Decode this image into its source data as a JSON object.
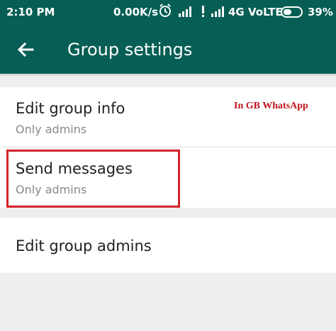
{
  "status_bar": {
    "time": "2:10 PM",
    "speed": "0.00K/s",
    "network": "4G VoLTE",
    "battery": "39%"
  },
  "app_bar": {
    "title": "Group settings",
    "color": "#075e54"
  },
  "settings": {
    "edit_group_info": {
      "title": "Edit group info",
      "subtitle": "Only admins"
    },
    "send_messages": {
      "title": "Send messages",
      "subtitle": "Only admins"
    },
    "edit_group_admins": {
      "title": "Edit group admins"
    }
  },
  "annotation": {
    "text": "In GB WhatsApp",
    "color": "#c0141c"
  },
  "highlight_color": "#d3222a",
  "icons": [
    "back-arrow-icon",
    "alarm-icon",
    "signal-icon",
    "no-sim-icon",
    "battery-icon"
  ]
}
